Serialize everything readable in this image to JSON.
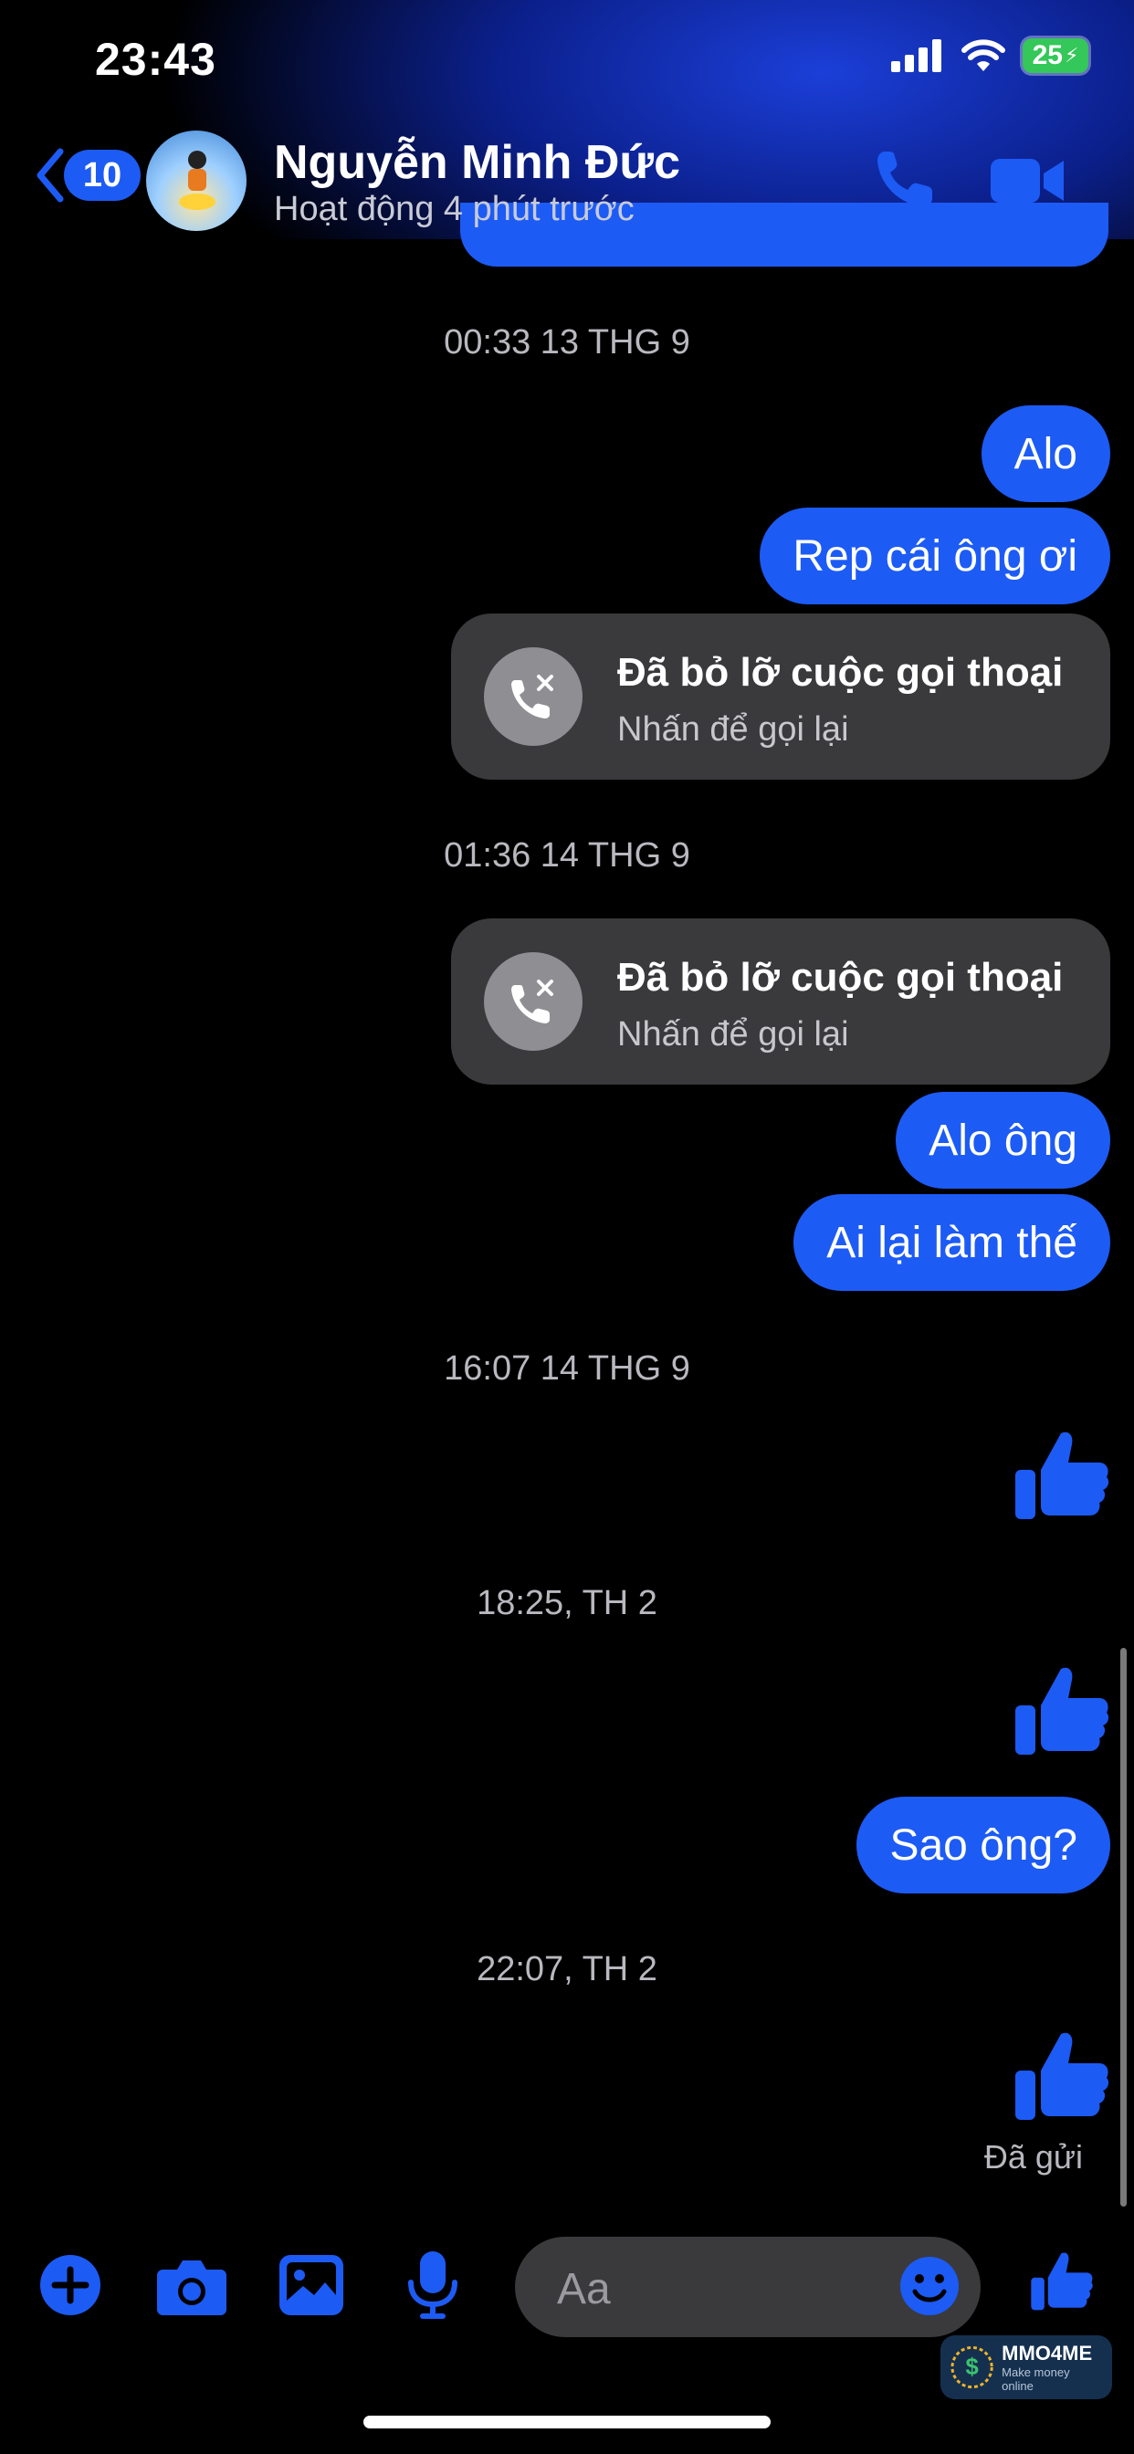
{
  "status_bar": {
    "time": "23:43",
    "battery": "25"
  },
  "header": {
    "back_count": "10",
    "contact_name": "Nguyễn Minh Đức",
    "contact_status": "Hoạt động 4 phút trước",
    "accent": "#1d5bf5"
  },
  "chat": {
    "ts1": "00:33 13 THG 9",
    "m1": "Alo",
    "m2": "Rep cái ông ơi",
    "call1_title": "Đã bỏ lỡ cuộc gọi thoại",
    "call1_sub": "Nhấn để gọi lại",
    "ts2": "01:36 14 THG 9",
    "call2_title": "Đã bỏ lỡ cuộc gọi thoại",
    "call2_sub": "Nhấn để gọi lại",
    "m3": "Alo ông",
    "m4": "Ai lại làm thế",
    "ts3": "16:07 14 THG 9",
    "ts4": "18:25, TH 2",
    "m5": "Sao ông?",
    "ts5": "22:07, TH 2",
    "sent_label": "Đã gửi"
  },
  "composer": {
    "placeholder": "Aa"
  },
  "watermark": {
    "title": "MMO4ME",
    "subtitle": "Make money online"
  }
}
